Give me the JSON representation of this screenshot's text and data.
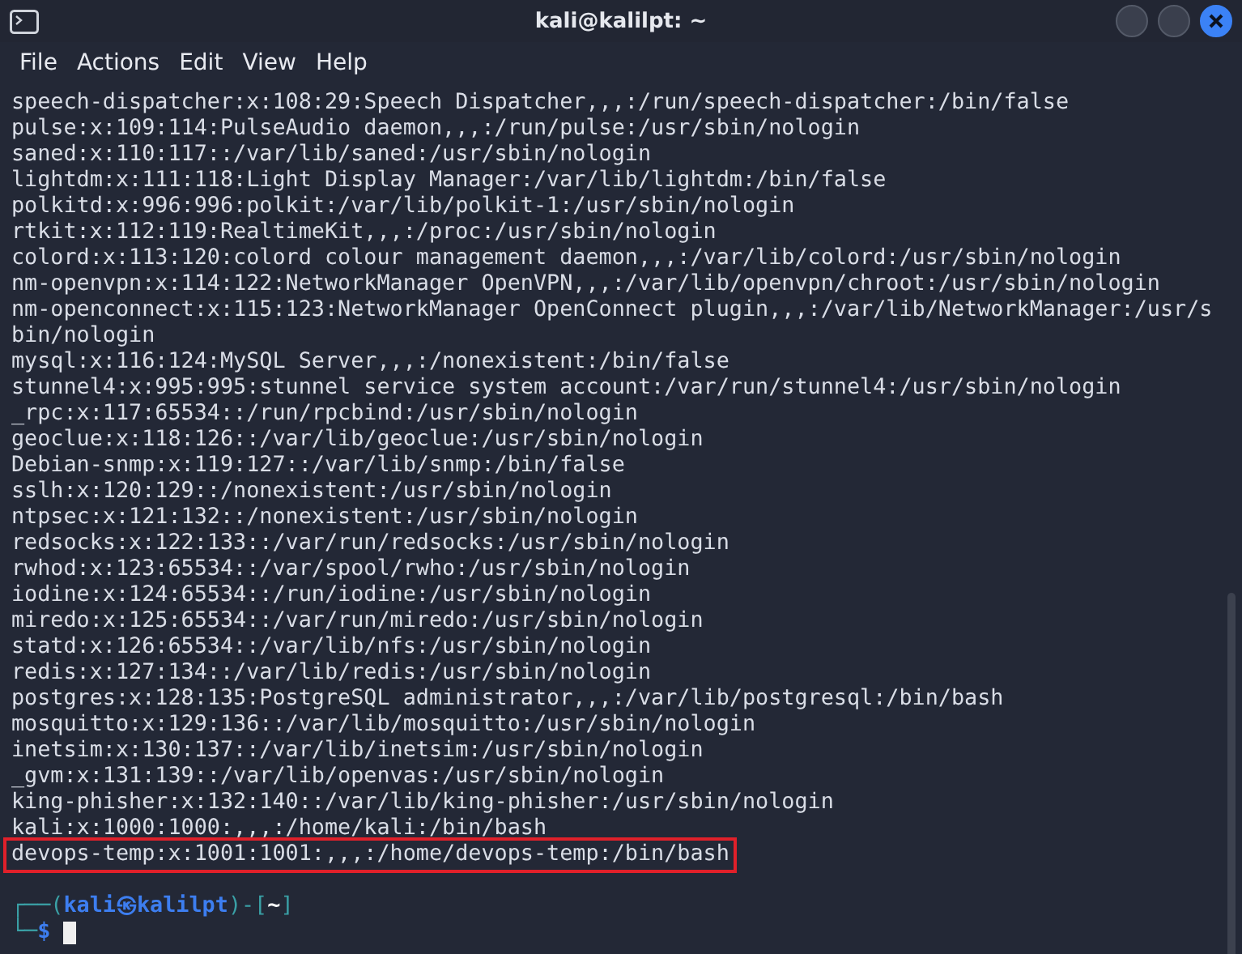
{
  "window": {
    "title": "kali@kalilpt: ~"
  },
  "menu": [
    "File",
    "Actions",
    "Edit",
    "View",
    "Help"
  ],
  "lines": [
    {
      "text": "speech-dispatcher:x:108:29:Speech Dispatcher,,,:/run/speech-dispatcher:/bin/false",
      "highlighted": false
    },
    {
      "text": "pulse:x:109:114:PulseAudio daemon,,,:/run/pulse:/usr/sbin/nologin",
      "highlighted": false
    },
    {
      "text": "saned:x:110:117::/var/lib/saned:/usr/sbin/nologin",
      "highlighted": false
    },
    {
      "text": "lightdm:x:111:118:Light Display Manager:/var/lib/lightdm:/bin/false",
      "highlighted": false
    },
    {
      "text": "polkitd:x:996:996:polkit:/var/lib/polkit-1:/usr/sbin/nologin",
      "highlighted": false
    },
    {
      "text": "rtkit:x:112:119:RealtimeKit,,,:/proc:/usr/sbin/nologin",
      "highlighted": false
    },
    {
      "text": "colord:x:113:120:colord colour management daemon,,,:/var/lib/colord:/usr/sbin/nologin",
      "highlighted": false
    },
    {
      "text": "nm-openvpn:x:114:122:NetworkManager OpenVPN,,,:/var/lib/openvpn/chroot:/usr/sbin/nologin",
      "highlighted": false
    },
    {
      "text": "nm-openconnect:x:115:123:NetworkManager OpenConnect plugin,,,:/var/lib/NetworkManager:/usr/s",
      "highlighted": false
    },
    {
      "text": "bin/nologin",
      "highlighted": false
    },
    {
      "text": "mysql:x:116:124:MySQL Server,,,:/nonexistent:/bin/false",
      "highlighted": false
    },
    {
      "text": "stunnel4:x:995:995:stunnel service system account:/var/run/stunnel4:/usr/sbin/nologin",
      "highlighted": false
    },
    {
      "text": "_rpc:x:117:65534::/run/rpcbind:/usr/sbin/nologin",
      "highlighted": false
    },
    {
      "text": "geoclue:x:118:126::/var/lib/geoclue:/usr/sbin/nologin",
      "highlighted": false
    },
    {
      "text": "Debian-snmp:x:119:127::/var/lib/snmp:/bin/false",
      "highlighted": false
    },
    {
      "text": "sslh:x:120:129::/nonexistent:/usr/sbin/nologin",
      "highlighted": false
    },
    {
      "text": "ntpsec:x:121:132::/nonexistent:/usr/sbin/nologin",
      "highlighted": false
    },
    {
      "text": "redsocks:x:122:133::/var/run/redsocks:/usr/sbin/nologin",
      "highlighted": false
    },
    {
      "text": "rwhod:x:123:65534::/var/spool/rwho:/usr/sbin/nologin",
      "highlighted": false
    },
    {
      "text": "iodine:x:124:65534::/run/iodine:/usr/sbin/nologin",
      "highlighted": false
    },
    {
      "text": "miredo:x:125:65534::/var/run/miredo:/usr/sbin/nologin",
      "highlighted": false
    },
    {
      "text": "statd:x:126:65534::/var/lib/nfs:/usr/sbin/nologin",
      "highlighted": false
    },
    {
      "text": "redis:x:127:134::/var/lib/redis:/usr/sbin/nologin",
      "highlighted": false
    },
    {
      "text": "postgres:x:128:135:PostgreSQL administrator,,,:/var/lib/postgresql:/bin/bash",
      "highlighted": false
    },
    {
      "text": "mosquitto:x:129:136::/var/lib/mosquitto:/usr/sbin/nologin",
      "highlighted": false
    },
    {
      "text": "inetsim:x:130:137::/var/lib/inetsim:/usr/sbin/nologin",
      "highlighted": false
    },
    {
      "text": "_gvm:x:131:139::/var/lib/openvas:/usr/sbin/nologin",
      "highlighted": false
    },
    {
      "text": "king-phisher:x:132:140::/var/lib/king-phisher:/usr/sbin/nologin",
      "highlighted": false
    },
    {
      "text": "kali:x:1000:1000:,,,:/home/kali:/bin/bash",
      "highlighted": false
    },
    {
      "text": "devops-temp:x:1001:1001:,,,:/home/devops-temp:/bin/bash",
      "highlighted": true
    }
  ],
  "prompt": {
    "line1": [
      {
        "text": "┌──(",
        "kind": "frame"
      },
      {
        "text": "kali㉿kalilpt",
        "kind": "user"
      },
      {
        "text": ")-[",
        "kind": "frame"
      },
      {
        "text": "~",
        "kind": "dir"
      },
      {
        "text": "]",
        "kind": "frame"
      }
    ],
    "line2": [
      {
        "text": "└─",
        "kind": "frame"
      },
      {
        "text": "$",
        "kind": "user"
      }
    ]
  }
}
